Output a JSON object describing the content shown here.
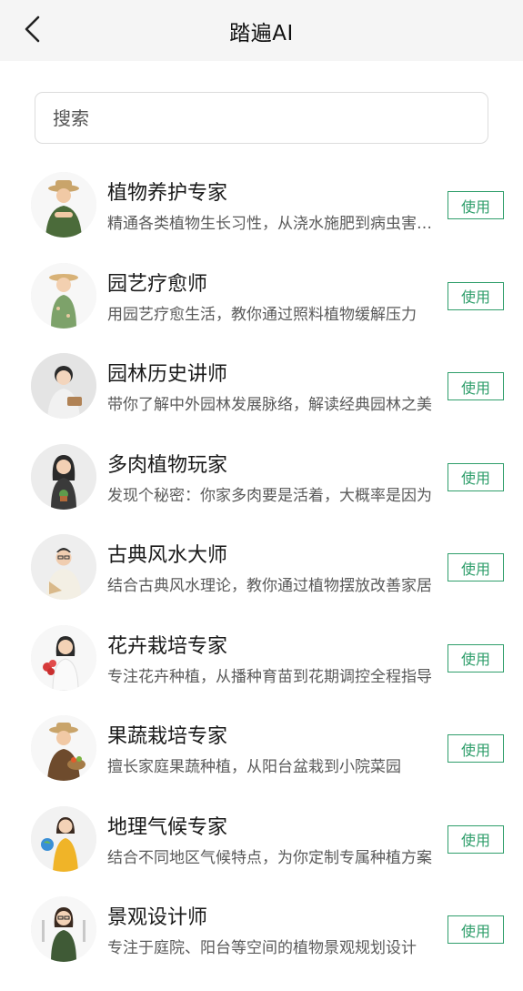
{
  "header": {
    "title": "踏遍AI",
    "back_icon": "chevron-left-icon"
  },
  "search": {
    "placeholder": "搜索",
    "value": ""
  },
  "colors": {
    "accent": "#2f9e6b",
    "header_bg": "#f5f5f5"
  },
  "experts": [
    {
      "name": "植物养护专家",
      "desc": "精通各类植物生长习性，从浇水施肥到病虫害防治",
      "button": "使用"
    },
    {
      "name": "园艺疗愈师",
      "desc": "用园艺疗愈生活，教你通过照料植物缓解压力",
      "button": "使用"
    },
    {
      "name": "园林历史讲师",
      "desc": "带你了解中外园林发展脉络，解读经典园林之美",
      "button": "使用"
    },
    {
      "name": "多肉植物玩家",
      "desc": "发现个秘密：你家多肉要是活着，大概率是因为",
      "button": "使用"
    },
    {
      "name": "古典风水大师",
      "desc": "结合古典风水理论，教你通过植物摆放改善家居",
      "button": "使用"
    },
    {
      "name": "花卉栽培专家",
      "desc": "专注花卉种植，从播种育苗到花期调控全程指导",
      "button": "使用"
    },
    {
      "name": "果蔬栽培专家",
      "desc": "擅长家庭果蔬种植，从阳台盆栽到小院菜园",
      "button": "使用"
    },
    {
      "name": "地理气候专家",
      "desc": "结合不同地区气候特点，为你定制专属种植方案",
      "button": "使用"
    },
    {
      "name": "景观设计师",
      "desc": "专注于庭院、阳台等空间的植物景观规划设计",
      "button": "使用"
    }
  ]
}
